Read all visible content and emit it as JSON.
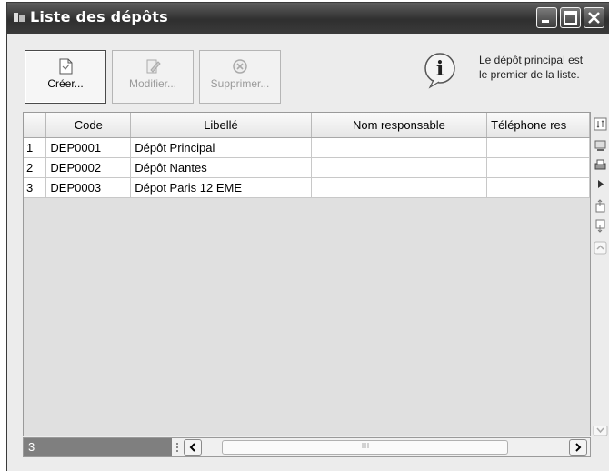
{
  "window": {
    "title": "Liste des dépôts"
  },
  "toolbar": {
    "create_label": "Créer...",
    "modify_label": "Modifier...",
    "delete_label": "Supprimer..."
  },
  "info": {
    "line1": "Le dépôt principal est",
    "line2": "le premier de la liste."
  },
  "table": {
    "columns": [
      "Code",
      "Libellé",
      "Nom responsable",
      "Téléphone res"
    ],
    "rows": [
      {
        "index": "1",
        "code": "DEP0001",
        "libelle": "Dépôt Principal",
        "responsable": "",
        "telephone": ""
      },
      {
        "index": "2",
        "code": "DEP0002",
        "libelle": "Dépôt Nantes",
        "responsable": "",
        "telephone": ""
      },
      {
        "index": "3",
        "code": "DEP0003",
        "libelle": "Dépot Paris 12 EME",
        "responsable": "",
        "telephone": ""
      }
    ]
  },
  "footer": {
    "row_count": "3"
  },
  "sidebar_icons": [
    "column-config-icon",
    "monitor-icon",
    "print-icon",
    "play-icon",
    "export-icon",
    "import-icon",
    "scroll-up-icon"
  ]
}
